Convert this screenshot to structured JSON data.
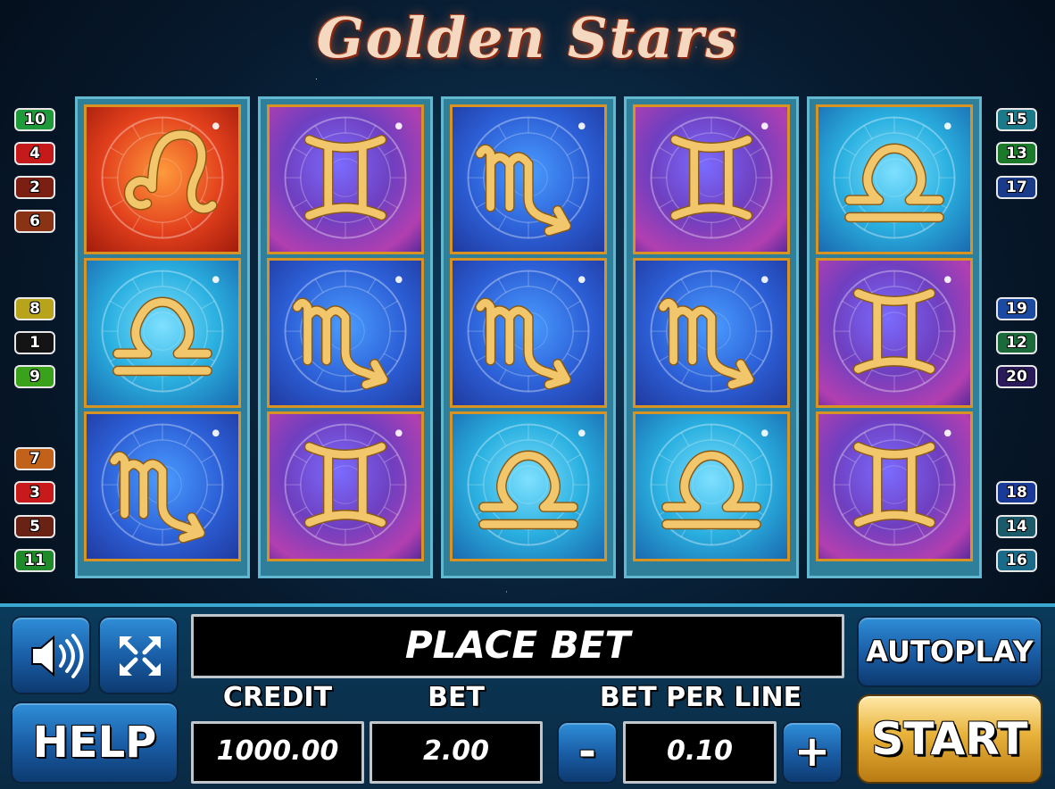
{
  "title": "Golden Stars",
  "reels": [
    [
      "leo",
      "libra",
      "scorpio"
    ],
    [
      "gemini",
      "scorpio",
      "gemini"
    ],
    [
      "scorpio",
      "scorpio",
      "libra"
    ],
    [
      "gemini",
      "scorpio",
      "libra"
    ],
    [
      "libra",
      "gemini",
      "gemini"
    ]
  ],
  "symbol_backgrounds": {
    "leo": "orange",
    "gemini": "purple",
    "scorpio": "blue",
    "libra": "cyan"
  },
  "paylines_left": [
    {
      "label": "10",
      "color": "#1f9a3a"
    },
    {
      "label": "4",
      "color": "#c41a1a"
    },
    {
      "label": "2",
      "color": "#7a1f12"
    },
    {
      "label": "6",
      "color": "#8a3214"
    },
    {
      "label": "8",
      "color": "#b7a41a"
    },
    {
      "label": "1",
      "color": "#141414"
    },
    {
      "label": "9",
      "color": "#3aa21a"
    },
    {
      "label": "7",
      "color": "#c2621a"
    },
    {
      "label": "3",
      "color": "#c81a1a"
    },
    {
      "label": "5",
      "color": "#6a2214"
    },
    {
      "label": "11",
      "color": "#1f8a2a"
    }
  ],
  "paylines_right": [
    {
      "label": "15",
      "color": "#1a7a8a"
    },
    {
      "label": "13",
      "color": "#1a7a2a"
    },
    {
      "label": "17",
      "color": "#1a3a8a"
    },
    {
      "label": "19",
      "color": "#1a4aa2"
    },
    {
      "label": "12",
      "color": "#1a6a3a"
    },
    {
      "label": "20",
      "color": "#2a1a5a"
    },
    {
      "label": "18",
      "color": "#1a3a9a"
    },
    {
      "label": "14",
      "color": "#1a5a6a"
    },
    {
      "label": "16",
      "color": "#1a6a8a"
    }
  ],
  "controls": {
    "sound_icon": "speaker-icon",
    "fullscreen_icon": "fullscreen-arrows-icon",
    "help_label": "HELP",
    "message": "PLACE BET",
    "autoplay_label": "AUTOPLAY",
    "start_label": "START",
    "credit_label": "CREDIT",
    "credit_value": "1000.00",
    "bet_label": "BET",
    "bet_value": "2.00",
    "bet_per_line_label": "BET PER LINE",
    "bet_per_line_value": "0.10",
    "minus_label": "-",
    "plus_label": "+"
  }
}
